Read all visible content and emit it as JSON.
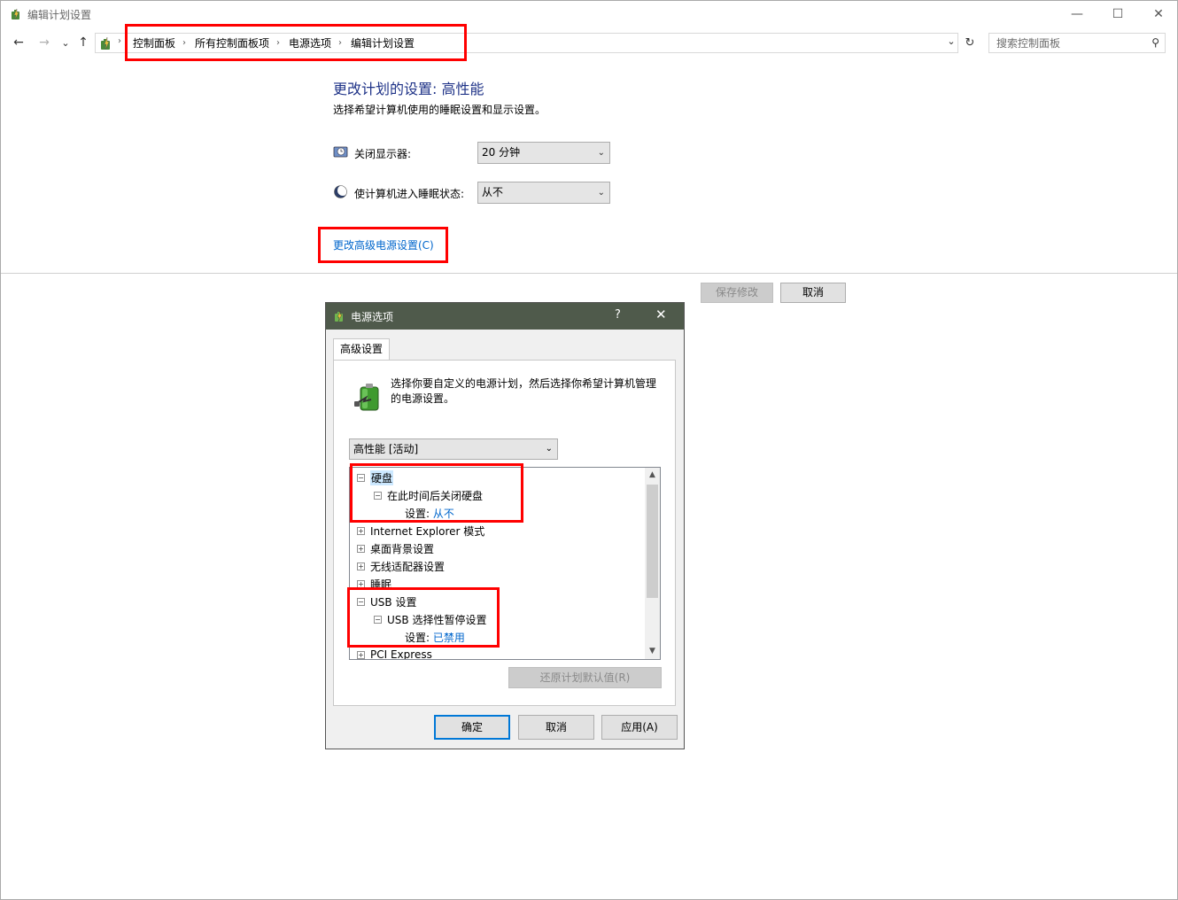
{
  "window": {
    "title": "编辑计划设置",
    "min_glyph": "—",
    "max_glyph": "☐",
    "close_glyph": "✕"
  },
  "nav": {
    "back_glyph": "←",
    "forward_glyph": "→",
    "recent_glyph": "⌄",
    "up_glyph": "↑",
    "drop_glyph": "⌄",
    "refresh_glyph": "↻"
  },
  "breadcrumb": {
    "items": [
      "控制面板",
      "所有控制面板项",
      "电源选项",
      "编辑计划设置"
    ],
    "separator": "›"
  },
  "search": {
    "placeholder": "搜索控制面板",
    "icon_glyph": "⚲"
  },
  "main": {
    "heading": "更改计划的设置: 高性能",
    "subheading": "选择希望计算机使用的睡眠设置和显示设置。",
    "display_off": {
      "label": "关闭显示器:",
      "value": "20 分钟"
    },
    "sleep": {
      "label": "使计算机进入睡眠状态:",
      "value": "从不"
    },
    "advanced_link": "更改高级电源设置(C)",
    "save_button": "保存修改",
    "cancel_button": "取消"
  },
  "dialog": {
    "title": "电源选项",
    "help_glyph": "?",
    "close_glyph": "✕",
    "tab_label": "高级设置",
    "description": "选择你要自定义的电源计划，然后选择你希望计算机管理的电源设置。",
    "plan_value": "高性能 [活动]",
    "tree": {
      "hard_disk": "硬盘",
      "turn_off_disk": "在此时间后关闭硬盘",
      "setting_label": "设置:",
      "turn_off_disk_value": "从不",
      "ie_mode": "Internet Explorer 模式",
      "desktop_bg": "桌面背景设置",
      "wireless": "无线适配器设置",
      "sleep": "睡眠",
      "usb": "USB 设置",
      "usb_suspend": "USB 选择性暂停设置",
      "usb_suspend_value": "已禁用",
      "pci": "PCI Express",
      "expanded_glyph": "−",
      "collapsed_glyph": "+"
    },
    "restore_button": "还原计划默认值(R)",
    "ok_button": "确定",
    "cancel_button": "取消",
    "apply_button": "应用(A)"
  },
  "colors": {
    "heading": "#1e3287",
    "link": "#0066cc",
    "highlight": "#ff0000",
    "dialog_title": "#4f5a4b"
  }
}
